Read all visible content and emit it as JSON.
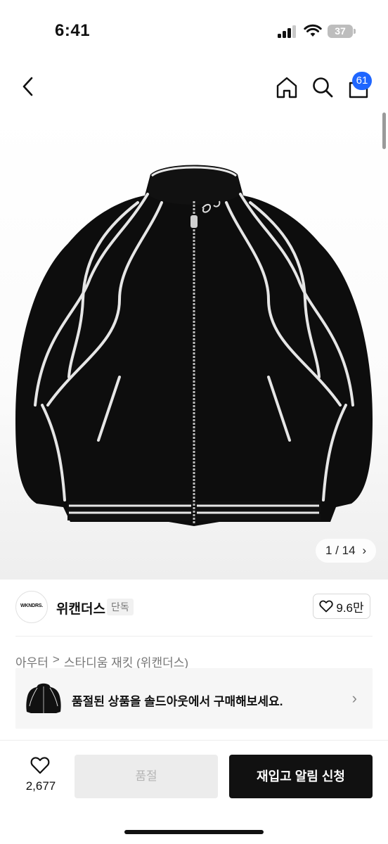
{
  "status_bar": {
    "time": "6:41",
    "battery": "37",
    "signal_icon": "cellular-signal-icon",
    "wifi_icon": "wifi-icon",
    "battery_icon": "battery-icon"
  },
  "header": {
    "back_icon": "chevron-left-icon",
    "home_icon": "home-icon",
    "search_icon": "search-icon",
    "cart_icon": "shopping-bag-icon",
    "cart_count": "61",
    "badge_color": "#1f66ff"
  },
  "gallery": {
    "current": "1",
    "total": "14",
    "pager_text": "1 / 14",
    "next_icon": "chevron-right-icon"
  },
  "brand": {
    "logo_text": "WKNDRS.",
    "name": "위캔더스",
    "exclusive_tag": "단독",
    "like_count": "9.6만",
    "like_icon": "heart-icon"
  },
  "breadcrumb": {
    "category": "아우터",
    "separator": ">",
    "product": "스타디움 재킷 (위캔더스)"
  },
  "soldout_banner": {
    "message": "품절된 상품을 솔드아웃에서 구매해보세요.",
    "chevron_icon": "chevron-right-icon"
  },
  "bottom_bar": {
    "wish_icon": "heart-icon",
    "wish_count": "2,677",
    "soldout_label": "품절",
    "restock_label": "재입고 알림 신청",
    "primary_color": "#111111"
  }
}
